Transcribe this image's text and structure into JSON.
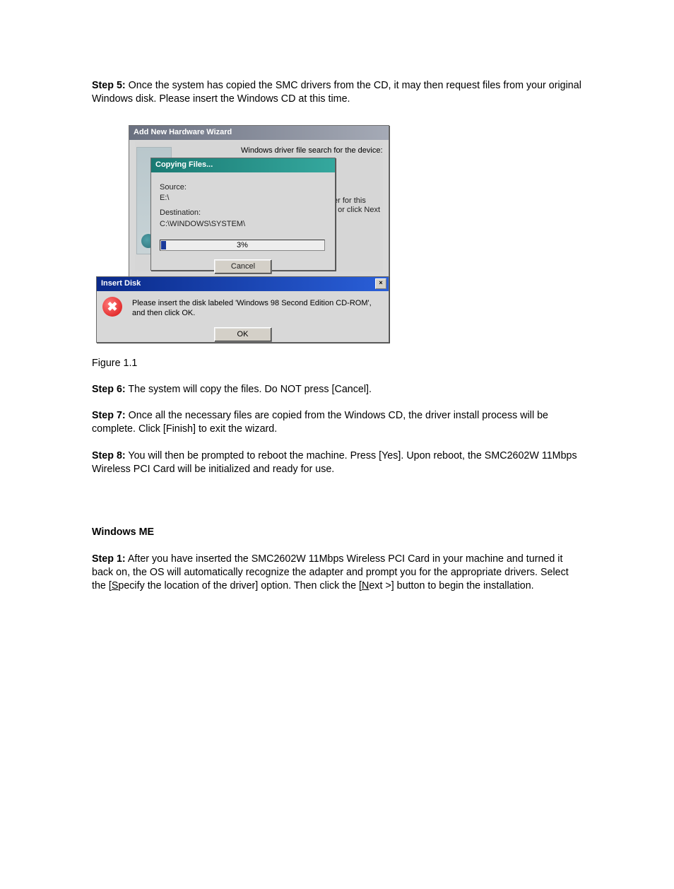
{
  "steps": {
    "s5_label": "Step 5:",
    "s5_text": " Once the system has copied the SMC drivers from the CD, it may then request files from your original Windows disk. Please insert the Windows CD at this time.",
    "s6_label": "Step 6:",
    "s6_text": " The system will copy the files. Do NOT press [Cancel].",
    "s7_label": "Step 7:",
    "s7_text": " Once all the necessary files are copied from the Windows CD, the driver install process will be complete. Click [Finish] to exit the wizard.",
    "s8_label": "Step 8:",
    "s8_text": " You will then be prompted to reboot the machine. Press [Yes]. Upon reboot, the SMC2602W 11Mbps Wireless PCI Card will be initialized and ready for use."
  },
  "figure_caption": "Figure 1.1",
  "heading_me": "Windows ME",
  "me_step1": {
    "label": "Step 1:",
    "before_specify": " After you have inserted the SMC2602W 11Mbps Wireless PCI Card in your machine and turned it back on, the OS will automatically recognize the adapter and prompt you for the appropriate drivers. Select the [",
    "specify_u": "S",
    "specify_rest": "pecify the location of the driver] option. Then click the [",
    "next_u": "N",
    "next_rest": "ext >] button to begin the installation."
  },
  "wizard": {
    "title": "Add New Hardware Wizard",
    "header_text": "Windows driver file search for the device:",
    "side_text_l1": "er for this",
    "side_text_l2": ", or click Next"
  },
  "copying": {
    "title": "Copying Files...",
    "source_label": "Source:",
    "source_value": "E:\\",
    "dest_label": "Destination:",
    "dest_value": "C:\\WINDOWS\\SYSTEM\\",
    "percent": "3%",
    "cancel": "Cancel"
  },
  "insertdisk": {
    "title": "Insert Disk",
    "message": "Please insert the disk labeled 'Windows 98 Second Edition CD-ROM', and then click OK.",
    "ok": "OK",
    "close_x": "×",
    "error_glyph": "✖"
  }
}
